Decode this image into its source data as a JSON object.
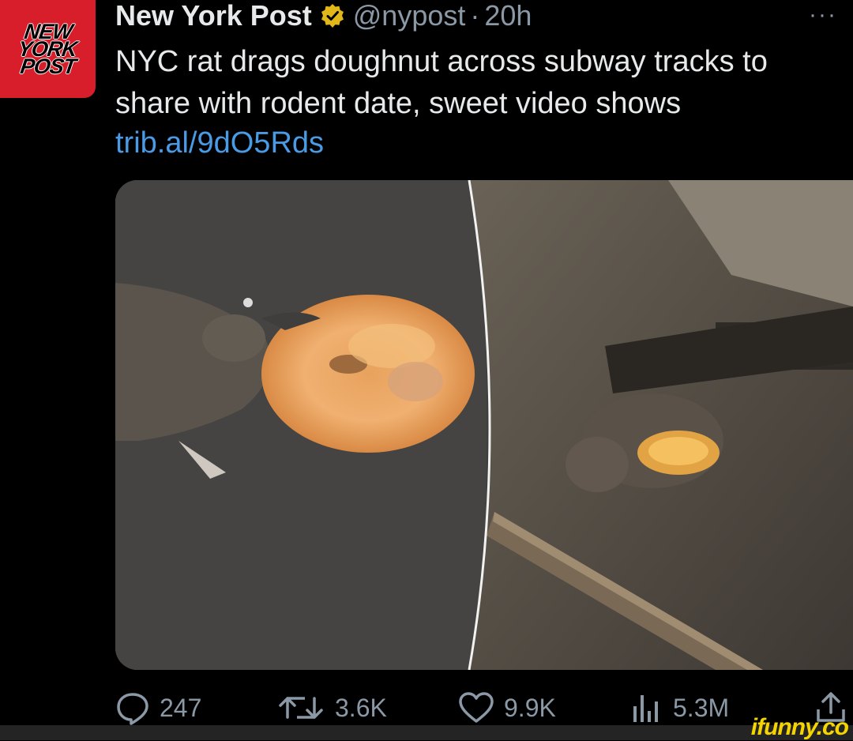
{
  "account": {
    "name": "New York Post",
    "handle": "@nypost",
    "separator": "·",
    "time": "20h",
    "avatar_lines": [
      "NEW",
      "YORK",
      "POST"
    ]
  },
  "menu": {
    "more_label": "···"
  },
  "tweet": {
    "text": "NYC rat drags doughnut across subway tracks to share with rodent date, sweet video shows",
    "link": "trib.al/9dO5Rds"
  },
  "media": {
    "icon": "image-collage"
  },
  "actions": {
    "replies": "247",
    "reposts": "3.6K",
    "likes": "9.9K",
    "views": "5.3M"
  },
  "watermark": "ifunny.co",
  "colors": {
    "background": "#000000",
    "text": "#e7e9ea",
    "muted": "#8b98a5",
    "link": "#4a9be6",
    "verified": "#e2b719",
    "brand_red": "#d81e2a",
    "watermark": "#f5d500"
  }
}
